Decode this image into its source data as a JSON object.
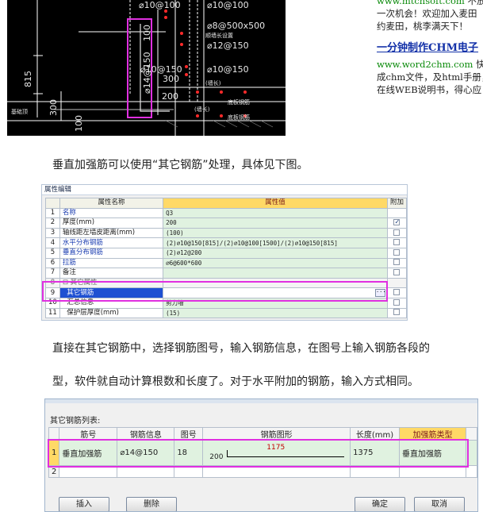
{
  "cad": {
    "dims_vertical": [
      "815",
      "300",
      "100"
    ],
    "labels": [
      "⌀10@100",
      "⌀10@100",
      "⌀8@500x500",
      "⌀12@150",
      "⌀10@150",
      "⌀10@150",
      "300",
      "200",
      "⌀14@150",
      "100"
    ],
    "notes": [
      "基础顶",
      "底板钢筋",
      "底板钢筋",
      "(墙长)",
      "(墙长)",
      "顺墙长设置"
    ]
  },
  "ads": {
    "line1_url": "www.mtcnsoft.com",
    "line1_text": "不放过",
    "line2": "一次机会！欢迎加入麦田",
    "line3": "约麦田，桃李满天下！",
    "title": "一分钟制作CHM电子",
    "line5_url": "www.word2chm.com",
    "line5_text": "快速",
    "line6": "成chm文件，及html手册，",
    "line7": "在线WEB说明书，得心应"
  },
  "para1": "垂直加强筋可以使用“其它钢筋”处理，具体见下图。",
  "para2": "直接在其它钢筋中，选择钢筋图号，输入钢筋信息，在图号上输入钢筋各段的",
  "para3": "型，软件就自动计算根数和长度了。对于水平附加的钢筋，输入方式相同。",
  "property_editor": {
    "title": "属性编辑",
    "headers": [
      "属性名称",
      "属性值",
      "附加"
    ],
    "rows": [
      {
        "num": "1",
        "name": "名称",
        "value": "Q3"
      },
      {
        "num": "2",
        "name": "厚度(mm)",
        "value": "200"
      },
      {
        "num": "3",
        "name": "轴线距左墙皮距离(mm)",
        "value": "(100)"
      },
      {
        "num": "4",
        "name": "水平分布钢筋",
        "value": "(2)⌀10@150[815]/(2)⌀10@100[1500]/(2)⌀10@150[815]"
      },
      {
        "num": "5",
        "name": "垂直分布钢筋",
        "value": "(2)⌀12@200"
      },
      {
        "num": "6",
        "name": "拉筋",
        "value": "⌀6@600*600"
      },
      {
        "num": "7",
        "name": "备注",
        "value": ""
      },
      {
        "num": "8",
        "name": "其它属性",
        "value": ""
      },
      {
        "num": "9",
        "name": "其它钢筋",
        "value": ""
      },
      {
        "num": "10",
        "name": "汇总信息",
        "value": "剪力墙"
      },
      {
        "num": "11",
        "name": "保护层厚度(mm)",
        "value": "(15)"
      }
    ],
    "checked_row": "2",
    "ellipsis": "···"
  },
  "rebar_dialog": {
    "title": "其它钢筋列表:",
    "headers": [
      "筋号",
      "钢筋信息",
      "图号",
      "钢筋图形",
      "长度(mm)",
      "加强筋类型"
    ],
    "rows": [
      {
        "num": "1",
        "bar_no": "垂直加强筋",
        "bar_info": "⌀14@150",
        "fig_no": "18",
        "shape_left": "200",
        "shape_center": "1175",
        "length": "1375",
        "type": "垂直加强筋"
      },
      {
        "num": "2",
        "bar_no": "",
        "bar_info": "",
        "fig_no": "",
        "shape_left": "",
        "shape_center": "",
        "length": "",
        "type": ""
      }
    ],
    "buttons": {
      "insert": "插入",
      "delete": "删除",
      "ok": "确定",
      "cancel": "取消"
    }
  },
  "colors": {
    "highlight_border": "#e030e0",
    "header_yellow": "#ffd966",
    "value_green": "#e0f2e0",
    "selection_blue": "#1e50d2"
  }
}
